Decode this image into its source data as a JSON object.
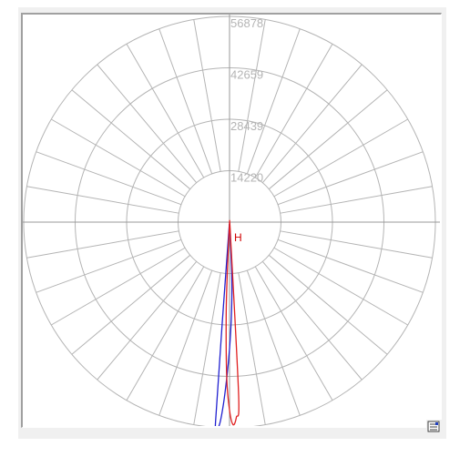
{
  "chart_data": {
    "type": "polar",
    "rings": [
      14220,
      28439,
      42659,
      56878
    ],
    "ring_labels": [
      "14220",
      "28439",
      "42659",
      "56878"
    ],
    "rmax": 56878,
    "angle_step_deg": 10,
    "grid": true,
    "series": [
      {
        "color": "#2020d0",
        "points": [
          {
            "angle": -6,
            "value": 500
          },
          {
            "angle": -4,
            "value": 55500
          },
          {
            "angle": -3,
            "value": 56500
          },
          {
            "angle": -2,
            "value": 51000
          },
          {
            "angle": -1,
            "value": 43000
          },
          {
            "angle": 0,
            "value": 35000
          },
          {
            "angle": 1,
            "value": 27000
          },
          {
            "angle": 2,
            "value": 19000
          },
          {
            "angle": 2.5,
            "value": 12500
          },
          {
            "angle": 3,
            "value": 2500
          },
          {
            "angle": 6,
            "value": 0
          }
        ]
      },
      {
        "color": "#e02020",
        "points": [
          {
            "angle": -3,
            "value": 0
          },
          {
            "angle": -2.5,
            "value": 15000
          },
          {
            "angle": -2,
            "value": 27000
          },
          {
            "angle": -1,
            "value": 43500
          },
          {
            "angle": 0,
            "value": 52000
          },
          {
            "angle": 1,
            "value": 56000
          },
          {
            "angle": 2,
            "value": 54000
          },
          {
            "angle": 3,
            "value": 48000
          },
          {
            "angle": 4,
            "value": 4500
          },
          {
            "angle": 5,
            "value": 0
          }
        ]
      }
    ],
    "marker_label": "H"
  },
  "icons": {
    "corner_button": "properties-icon"
  }
}
